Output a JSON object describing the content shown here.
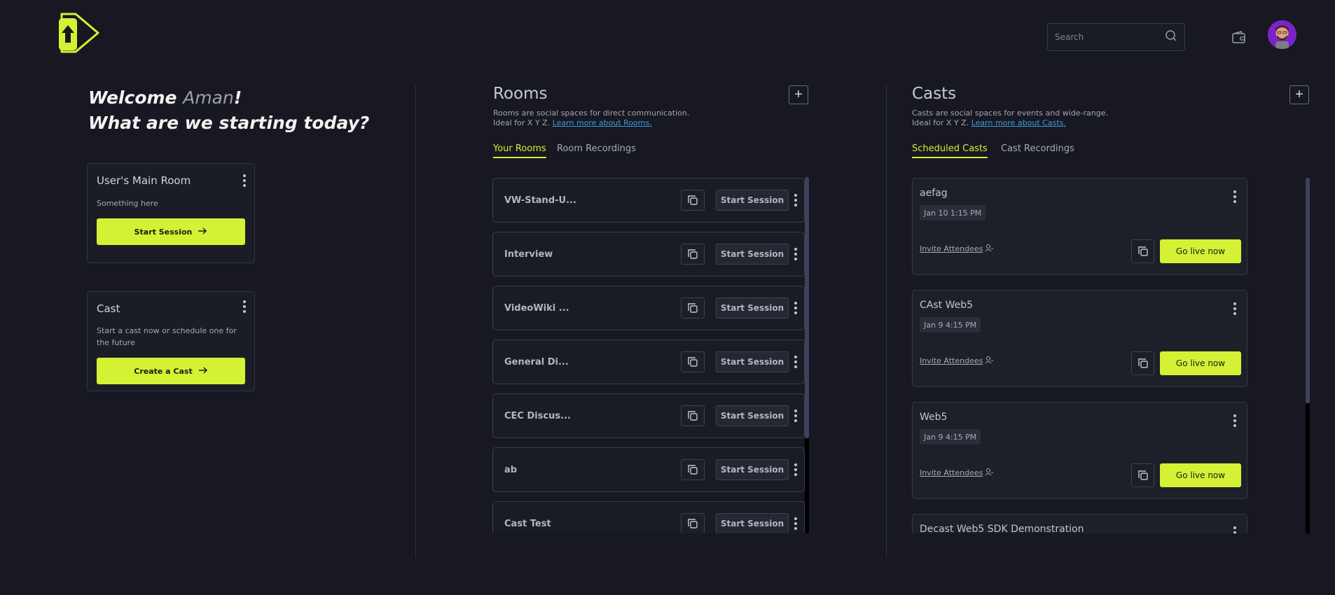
{
  "header": {
    "search_placeholder": "Search"
  },
  "welcome": {
    "prefix": "Welcome ",
    "user": "Aman",
    "suffix": "!",
    "line2": "What are we starting today?"
  },
  "main_room_card": {
    "title": "User's Main Room",
    "description": "Something here",
    "button": "Start Session"
  },
  "cast_card": {
    "title": "Cast",
    "description": "Start a cast now or schedule one for the future",
    "button": "Create a Cast"
  },
  "rooms": {
    "title": "Rooms",
    "desc_line1": "Rooms are social spaces for direct communication.",
    "desc_line2": "Ideal for X Y Z.",
    "learn_more": "Learn more about Rooms.",
    "tabs": [
      "Your Rooms",
      "Room Recordings"
    ],
    "start_label": "Start Session",
    "items": [
      {
        "name": "VW-Stand-U..."
      },
      {
        "name": "Interview"
      },
      {
        "name": "VideoWiki ..."
      },
      {
        "name": "General Di..."
      },
      {
        "name": "CEC Discus..."
      },
      {
        "name": "ab"
      },
      {
        "name": "Cast Test"
      }
    ]
  },
  "casts": {
    "title": "Casts",
    "desc_line1": "Casts are social spaces for events and wide-range.",
    "desc_line2": "Ideal for X Y Z.",
    "learn_more": "Learn more about Casts.",
    "tabs": [
      "Scheduled Casts",
      "Cast Recordings"
    ],
    "invite_label": "Invite Attendees",
    "golive_label": "Go live now",
    "items": [
      {
        "name": "aefag",
        "date": "Jan 10 1:15 PM"
      },
      {
        "name": "CAst Web5",
        "date": "Jan 9 4:15 PM"
      },
      {
        "name": "Web5",
        "date": "Jan 9 4:15 PM"
      },
      {
        "name": "Decast Web5 SDK Demonstration",
        "date": ""
      }
    ]
  },
  "colors": {
    "accent": "#d4f135",
    "background": "#171821",
    "link": "#3e9bdc"
  }
}
